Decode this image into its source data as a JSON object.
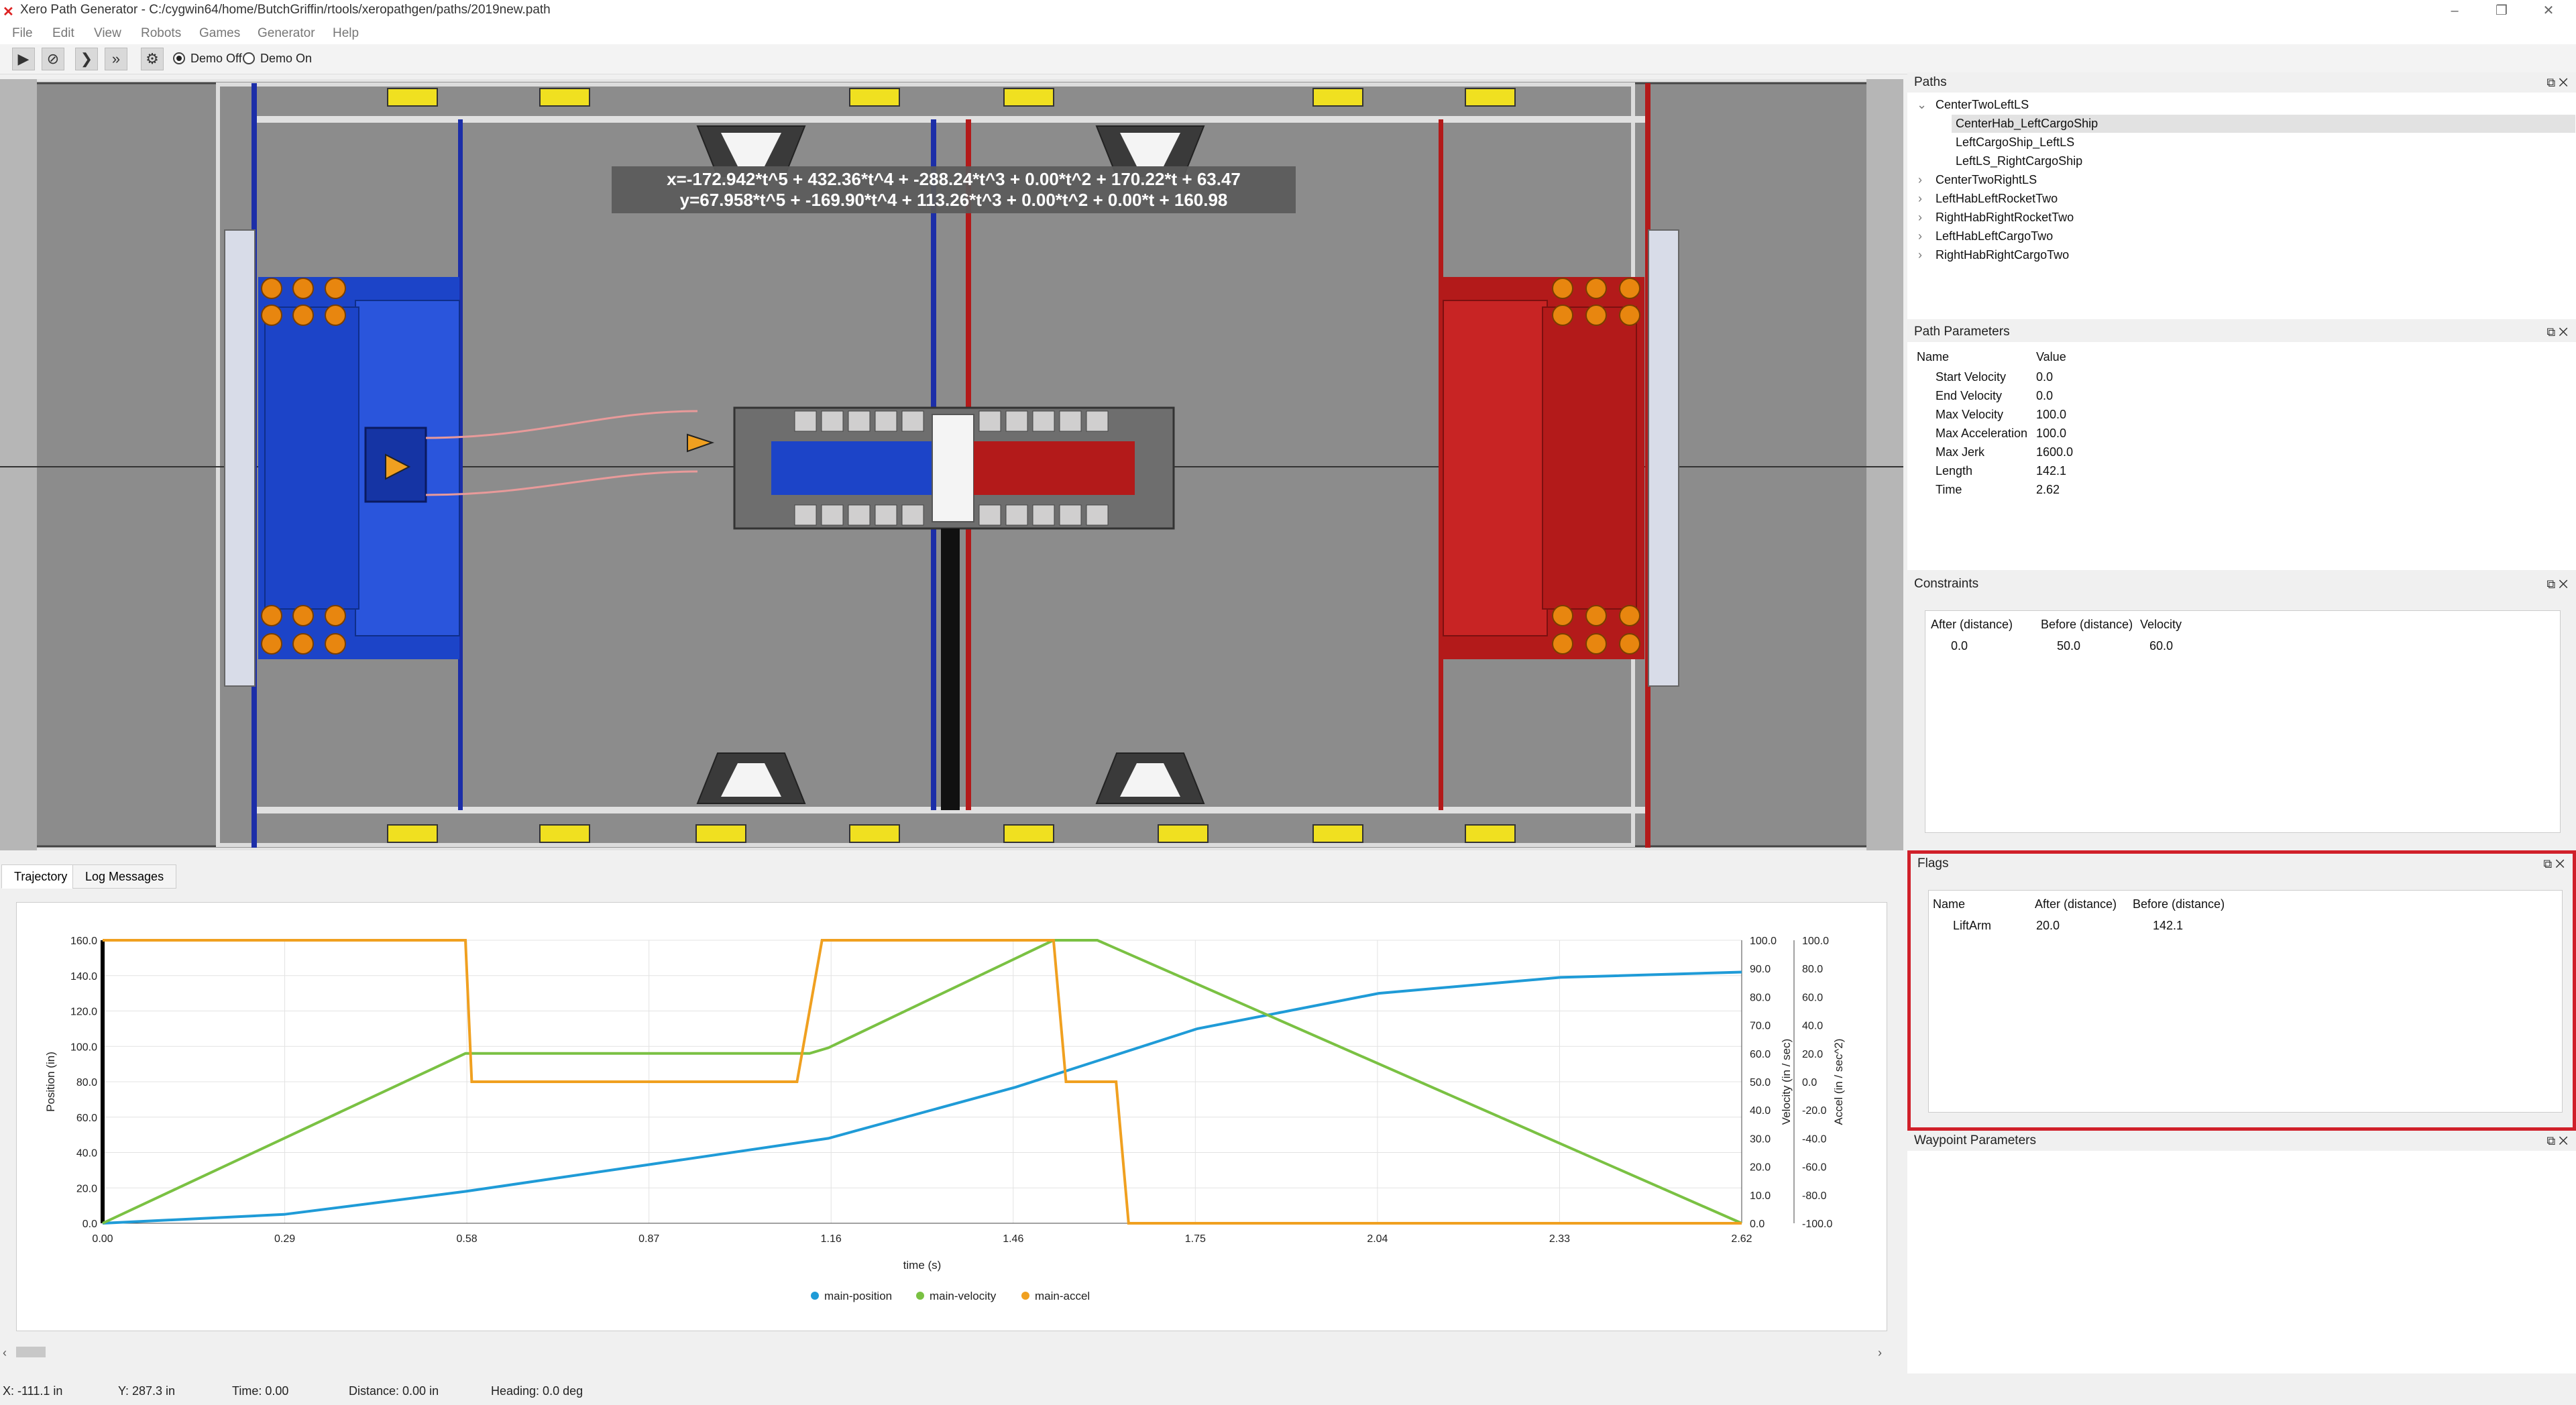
{
  "window": {
    "title": "Xero Path Generator - C:/cygwin64/home/ButchGriffin/rtools/xeropathgen/paths/2019new.path",
    "controls": [
      "–",
      "❐",
      "✕"
    ]
  },
  "menu": [
    "File",
    "Edit",
    "View",
    "Robots",
    "Games",
    "Generator",
    "Help"
  ],
  "toolbar": {
    "buttons": [
      "play-icon",
      "stop-icon",
      "step-icon",
      "fast-forward-icon",
      "settings-icon"
    ],
    "demo_off": "Demo Off",
    "demo_on": "Demo On",
    "demo_selected": "Demo Off"
  },
  "field": {
    "equation_x": "x=-172.942*t^5 + 432.36*t^4 + -288.24*t^3 + 0.00*t^2 + 170.22*t + 63.47",
    "equation_y": "y=67.958*t^5 + -169.90*t^4 + 113.26*t^3 + 0.00*t^2 + 0.00*t + 160.98",
    "colors": {
      "blue": "#1c44c8",
      "red": "#b31a1a",
      "floor": "#8c8c8c",
      "cargo": "#e8860f",
      "path": "#e89a9a"
    }
  },
  "tabs": [
    "Trajectory",
    "Log Messages"
  ],
  "active_tab": "Trajectory",
  "chart_data": {
    "type": "line",
    "xlabel": "time (s)",
    "x_ticks": [
      "0.00",
      "0.29",
      "0.58",
      "0.87",
      "1.16",
      "1.46",
      "1.75",
      "2.04",
      "2.33",
      "2.62"
    ],
    "xlim": [
      0,
      2.62
    ],
    "axes": [
      {
        "label": "Position (in)",
        "side": "left",
        "ticks": [
          "0.0",
          "20.0",
          "40.0",
          "60.0",
          "80.0",
          "100.0",
          "120.0",
          "140.0",
          "160.0"
        ],
        "range": [
          0,
          160
        ]
      },
      {
        "label": "Velocity (in / sec)",
        "side": "right",
        "ticks": [
          "0.0",
          "10.0",
          "20.0",
          "30.0",
          "40.0",
          "50.0",
          "60.0",
          "70.0",
          "80.0",
          "90.0",
          "100.0"
        ],
        "range": [
          0,
          100
        ]
      },
      {
        "label": "Accel (in / sec^2)",
        "side": "right",
        "ticks": [
          "-100.0",
          "-80.0",
          "-60.0",
          "-40.0",
          "-20.0",
          "0.0",
          "20.0",
          "40.0",
          "60.0",
          "80.0",
          "100.0"
        ],
        "range": [
          -100,
          100
        ]
      }
    ],
    "series": [
      {
        "name": "main-position",
        "axis": 0,
        "color": "#1f9bd7",
        "x": [
          0,
          0.29,
          0.58,
          0.87,
          1.16,
          1.46,
          1.75,
          2.04,
          2.33,
          2.62
        ],
        "y": [
          0,
          5,
          18,
          33,
          48,
          77,
          110,
          130,
          139,
          142
        ]
      },
      {
        "name": "main-velocity",
        "axis": 1,
        "color": "#7ac143",
        "x": [
          0,
          0.58,
          1.13,
          1.16,
          1.52,
          1.59,
          2.62
        ],
        "y": [
          0,
          60,
          60,
          62,
          100,
          100,
          0
        ]
      },
      {
        "name": "main-accel",
        "axis": 2,
        "color": "#f0a020",
        "x": [
          0,
          0.58,
          0.59,
          1.11,
          1.15,
          1.52,
          1.54,
          1.62,
          1.64,
          2.62
        ],
        "y": [
          100,
          100,
          0,
          0,
          100,
          100,
          0,
          0,
          -100,
          -100
        ]
      }
    ],
    "legend": "bottom",
    "grid": true
  },
  "panels": {
    "paths": {
      "title": "Paths",
      "tree": [
        {
          "label": "CenterTwoLeftLS",
          "expanded": true,
          "children": [
            {
              "label": "CenterHab_LeftCargoShip",
              "selected": true
            },
            {
              "label": "LeftCargoShip_LeftLS"
            },
            {
              "label": "LeftLS_RightCargoShip"
            }
          ]
        },
        {
          "label": "CenterTwoRightLS"
        },
        {
          "label": "LeftHabLeftRocketTwo"
        },
        {
          "label": "RightHabRightRocketTwo"
        },
        {
          "label": "LeftHabLeftCargoTwo"
        },
        {
          "label": "RightHabRightCargoTwo"
        }
      ]
    },
    "path_parameters": {
      "title": "Path Parameters",
      "headers": [
        "Name",
        "Value"
      ],
      "rows": [
        [
          "Start Velocity",
          "0.0"
        ],
        [
          "End Velocity",
          "0.0"
        ],
        [
          "Max Velocity",
          "100.0"
        ],
        [
          "Max Acceleration",
          "100.0"
        ],
        [
          "Max Jerk",
          "1600.0"
        ],
        [
          "Length",
          "142.1"
        ],
        [
          "Time",
          "2.62"
        ]
      ]
    },
    "constraints": {
      "title": "Constraints",
      "headers": [
        "After (distance)",
        "Before (distance)",
        "Velocity"
      ],
      "rows": [
        [
          "0.0",
          "50.0",
          "60.0"
        ]
      ]
    },
    "flags": {
      "title": "Flags",
      "headers": [
        "Name",
        "After (distance)",
        "Before (distance)"
      ],
      "rows": [
        [
          "LiftArm",
          "20.0",
          "142.1"
        ]
      ],
      "highlight_color": "#d0202a"
    },
    "waypoint_parameters": {
      "title": "Waypoint Parameters"
    },
    "panel_buttons": "⧉ ✕"
  },
  "status": {
    "x": "X: -111.1 in",
    "y": "Y: 287.3 in",
    "time": "Time: 0.00",
    "distance": "Distance: 0.00 in",
    "heading": "Heading: 0.0 deg"
  }
}
